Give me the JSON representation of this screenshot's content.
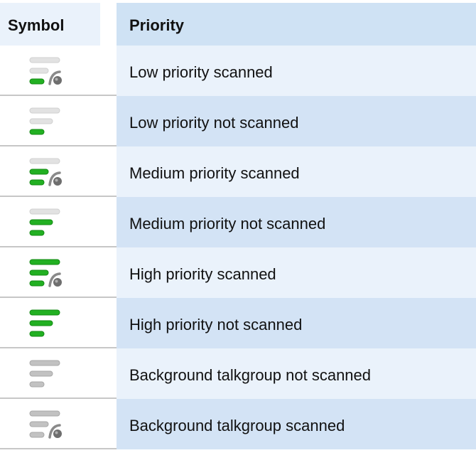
{
  "header": {
    "symbol_label": "Symbol",
    "priority_label": "Priority"
  },
  "colors": {
    "green_fill": "#22b022",
    "green_stroke": "#138a13",
    "light_gray": "#e2e2e2",
    "mid_gray": "#c2c2c2",
    "dark_gray": "#8a8a8a",
    "row_light": "#eaf2fb",
    "row_dark": "#d3e3f5"
  },
  "rows": [
    {
      "label": "Low priority scanned",
      "icon": "low-priority-scanned-icon",
      "green_bars": 1,
      "scanned": true,
      "background": false
    },
    {
      "label": "Low priority not scanned",
      "icon": "low-priority-not-scanned-icon",
      "green_bars": 1,
      "scanned": false,
      "background": false
    },
    {
      "label": "Medium priority scanned",
      "icon": "medium-priority-scanned-icon",
      "green_bars": 2,
      "scanned": true,
      "background": false
    },
    {
      "label": "Medium priority not scanned",
      "icon": "medium-priority-not-scanned-icon",
      "green_bars": 2,
      "scanned": false,
      "background": false
    },
    {
      "label": "High priority scanned",
      "icon": "high-priority-scanned-icon",
      "green_bars": 3,
      "scanned": true,
      "background": false
    },
    {
      "label": "High priority not scanned",
      "icon": "high-priority-not-scanned-icon",
      "green_bars": 3,
      "scanned": false,
      "background": false
    },
    {
      "label": "Background talkgroup not scanned",
      "icon": "background-talkgroup-not-scanned-icon",
      "green_bars": 0,
      "scanned": false,
      "background": true
    },
    {
      "label": "Background talkgroup scanned",
      "icon": "background-talkgroup-scanned-icon",
      "green_bars": 0,
      "scanned": true,
      "background": true
    }
  ]
}
